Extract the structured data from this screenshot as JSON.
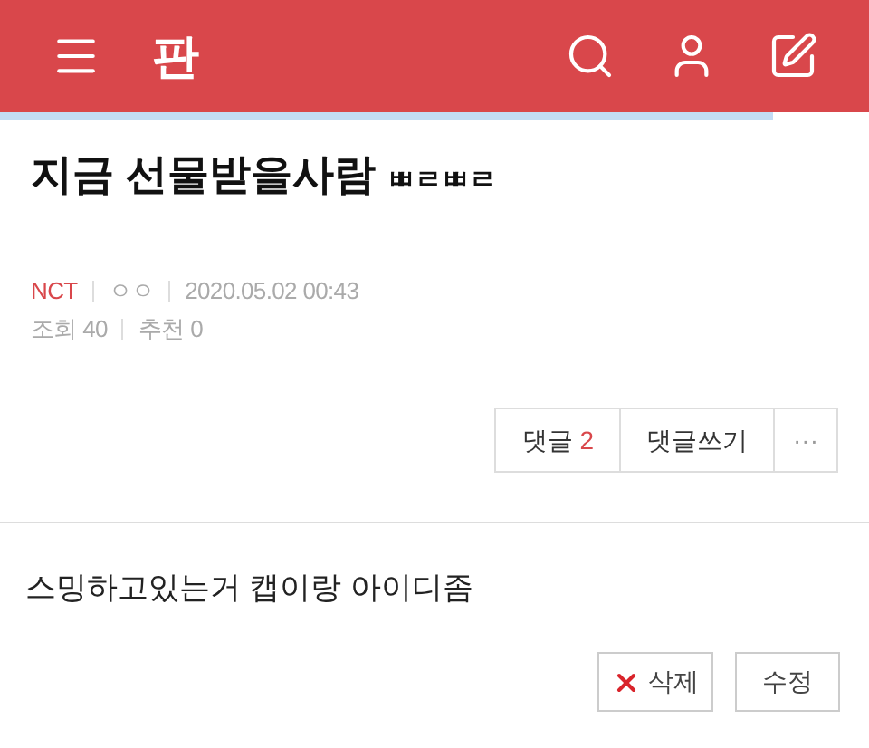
{
  "header": {
    "logo": "판",
    "progress": {
      "level": 0.89
    }
  },
  "post": {
    "title": "지금 선물받을사람",
    "title_suffix": "ㅃㄹㅃㄹ",
    "category": "NCT",
    "author": "ㅇㅇ",
    "date": "2020.05.02 00:43",
    "views": "조회 40",
    "recommends": "추천 0"
  },
  "actions": {
    "comments_label": "댓글",
    "comments_count": "2",
    "write_comment": "댓글쓰기",
    "more": "···"
  },
  "comment": {
    "text": "스밍하고있는거 캡이랑 아이디좀",
    "delete": "삭제",
    "edit": "수정"
  }
}
